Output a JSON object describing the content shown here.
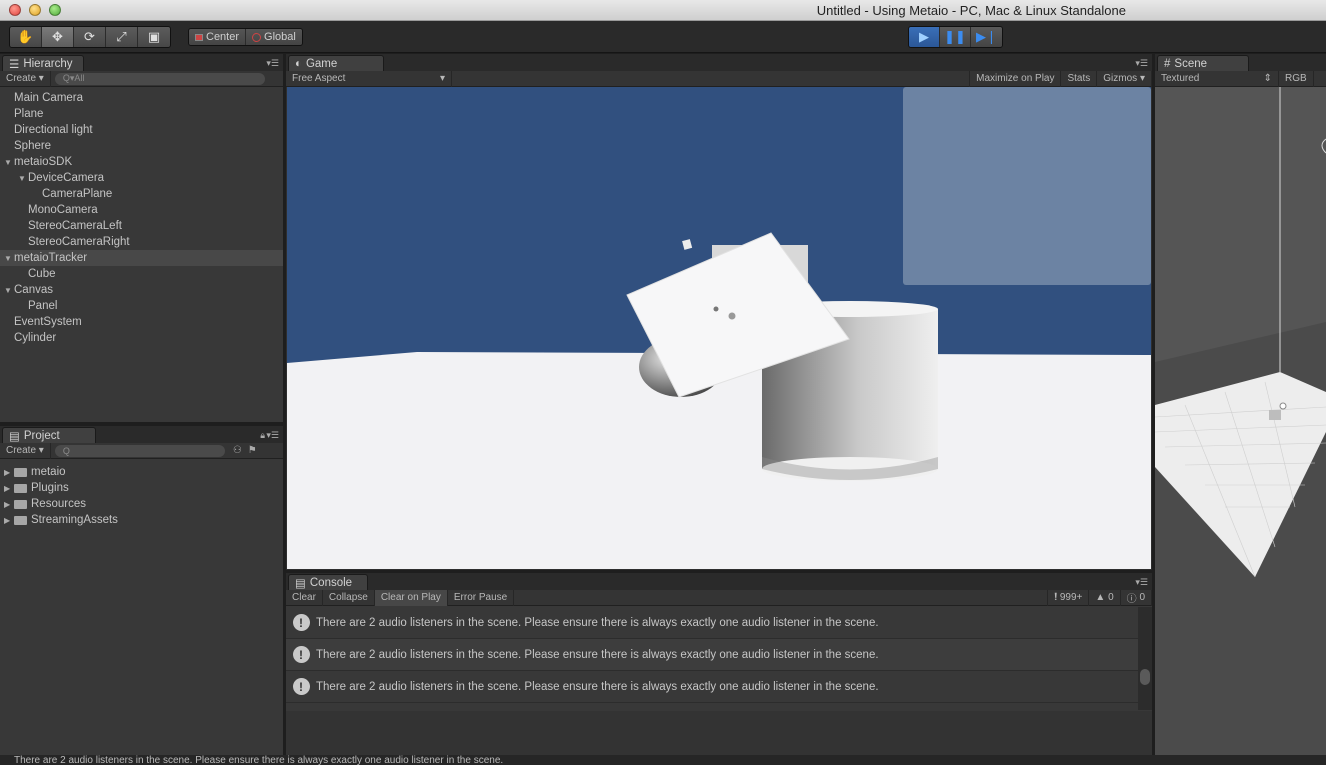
{
  "window": {
    "title": "Untitled - Using Metaio - PC, Mac & Linux Standalone"
  },
  "toolbar": {
    "tools": [
      {
        "name": "hand-tool",
        "glyph": "✋"
      },
      {
        "name": "move-tool",
        "glyph": "✥"
      },
      {
        "name": "rotate-tool",
        "glyph": "⟳"
      },
      {
        "name": "scale-tool",
        "glyph": "⤢"
      },
      {
        "name": "rect-tool",
        "glyph": "▣"
      }
    ],
    "pivot_label": "Center",
    "space_label": "Global"
  },
  "hierarchy": {
    "tab_label": "Hierarchy",
    "create_label": "Create",
    "search_placeholder": "Q▾All",
    "items": [
      {
        "label": "Main Camera",
        "depth": 0,
        "arrow": ""
      },
      {
        "label": "Plane",
        "depth": 0,
        "arrow": ""
      },
      {
        "label": "Directional light",
        "depth": 0,
        "arrow": ""
      },
      {
        "label": "Sphere",
        "depth": 0,
        "arrow": ""
      },
      {
        "label": "metaioSDK",
        "depth": 0,
        "arrow": "▼"
      },
      {
        "label": "DeviceCamera",
        "depth": 1,
        "arrow": "▼"
      },
      {
        "label": "CameraPlane",
        "depth": 2,
        "arrow": ""
      },
      {
        "label": "MonoCamera",
        "depth": 1,
        "arrow": ""
      },
      {
        "label": "StereoCameraLeft",
        "depth": 1,
        "arrow": ""
      },
      {
        "label": "StereoCameraRight",
        "depth": 1,
        "arrow": ""
      },
      {
        "label": "metaioTracker",
        "depth": 0,
        "arrow": "▼",
        "selected": true
      },
      {
        "label": "Cube",
        "depth": 1,
        "arrow": ""
      },
      {
        "label": "Canvas",
        "depth": 0,
        "arrow": "▼"
      },
      {
        "label": "Panel",
        "depth": 1,
        "arrow": ""
      },
      {
        "label": "EventSystem",
        "depth": 0,
        "arrow": ""
      },
      {
        "label": "Cylinder",
        "depth": 0,
        "arrow": ""
      }
    ]
  },
  "project": {
    "tab_label": "Project",
    "create_label": "Create",
    "folders": [
      "metaio",
      "Plugins",
      "Resources",
      "StreamingAssets"
    ]
  },
  "game": {
    "tab_label": "Game",
    "aspect": "Free Aspect",
    "maximize_label": "Maximize on Play",
    "stats_label": "Stats",
    "gizmos_label": "Gizmos",
    "sky_color": "#31507f",
    "ground_color": "#f2f2f4"
  },
  "scene": {
    "tab_label": "Scene",
    "shading": "Textured",
    "channel": "RGB"
  },
  "console": {
    "tab_label": "Console",
    "buttons": [
      "Clear",
      "Collapse",
      "Clear on Play",
      "Error Pause"
    ],
    "count_errors": "999+",
    "count_warnings": "0",
    "count_logs": "0",
    "messages": [
      "There are 2 audio listeners in the scene. Please ensure there is always exactly one audio listener in the scene.",
      "There are 2 audio listeners in the scene. Please ensure there is always exactly one audio listener in the scene.",
      "There are 2 audio listeners in the scene. Please ensure there is always exactly one audio listener in the scene."
    ]
  },
  "status": {
    "message": "There are 2 audio listeners in the scene. Please ensure there is always exactly one audio listener in the scene."
  }
}
